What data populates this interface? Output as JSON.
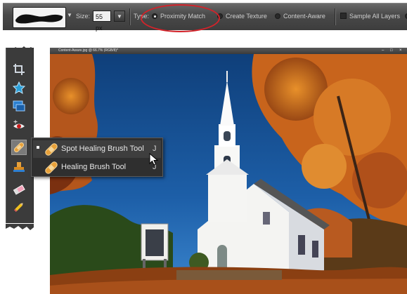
{
  "options_bar": {
    "size_label": "Size:",
    "size_value": "55 px",
    "type_label": "Type:",
    "types": [
      {
        "label": "Proximity Match",
        "selected": true
      },
      {
        "label": "Create Texture",
        "selected": false
      },
      {
        "label": "Content-Aware",
        "selected": false
      }
    ],
    "sample_all_layers_label": "Sample All Layers",
    "sample_all_layers_checked": false
  },
  "document": {
    "title": "Content-Aware.jpg @ 66.7% (RGB/8)*"
  },
  "toolbox": {
    "tools": [
      {
        "name": "crop-icon"
      },
      {
        "name": "cookie-cutter-icon"
      },
      {
        "name": "recompose-icon"
      },
      {
        "name": "red-eye-icon"
      },
      {
        "name": "spot-healing-brush-icon",
        "selected": true
      },
      {
        "name": "clone-stamp-icon"
      },
      {
        "name": "eraser-icon"
      },
      {
        "name": "pencil-icon"
      }
    ]
  },
  "flyout": {
    "items": [
      {
        "label": "Spot Healing Brush Tool",
        "shortcut": "J",
        "selected": true
      },
      {
        "label": "Healing Brush Tool",
        "shortcut": "J",
        "selected": false
      }
    ]
  },
  "colors": {
    "toolbar_bg": "#4a4a4a",
    "highlight_ring": "#d2232a",
    "sky": "#1d5fa8",
    "foliage": "#c8641c"
  }
}
